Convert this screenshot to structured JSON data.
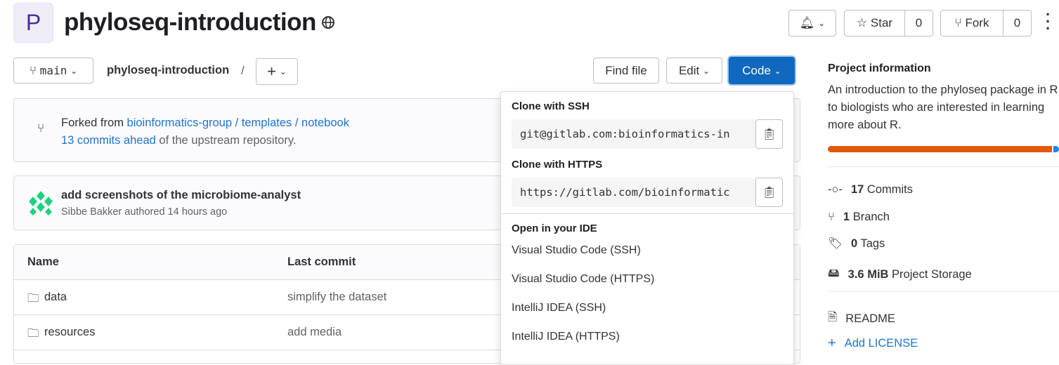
{
  "project": {
    "avatar_letter": "P",
    "title": "phyloseq-introduction",
    "visibility_icon": "globe-icon"
  },
  "header": {
    "star_label": "Star",
    "star_count": "0",
    "fork_label": "Fork",
    "fork_count": "0"
  },
  "toolbar": {
    "branch": "main",
    "breadcrumb": "phyloseq-introduction",
    "separator": "/",
    "find_file": "Find file",
    "edit": "Edit",
    "code": "Code"
  },
  "fork_info": {
    "prefix": "Forked from",
    "source": "bioinformatics-group / templates / notebook",
    "ahead": "13 commits ahead",
    "suffix": "of the upstream repository."
  },
  "last_commit": {
    "message": "add screenshots of the microbiome-analyst",
    "author_line": "Sibbe Bakker authored 14 hours ago"
  },
  "table": {
    "headers": [
      "Name",
      "Last commit"
    ],
    "rows": [
      {
        "name": "data",
        "commit": "simplify the dataset"
      },
      {
        "name": "resources",
        "commit": "add media"
      }
    ]
  },
  "code_dropdown": {
    "ssh_title": "Clone with SSH",
    "ssh_url": "git@gitlab.com:bioinformatics-in",
    "https_title": "Clone with HTTPS",
    "https_url": "https://gitlab.com/bioinformatic",
    "ide_title": "Open in your IDE",
    "ide_options": [
      "Visual Studio Code (SSH)",
      "Visual Studio Code (HTTPS)",
      "IntelliJ IDEA (SSH)",
      "IntelliJ IDEA (HTTPS)"
    ]
  },
  "sidebar": {
    "title": "Project information",
    "description": "An introduction to the phyloseq package in R, to biologists who are interested in learning more about R.",
    "languages": [
      {
        "percent": 97.5,
        "color": "#e0590b"
      },
      {
        "percent": 2.5,
        "color": "#1f87e5"
      }
    ],
    "commits_n": "17",
    "commits_l": "Commits",
    "branch_n": "1",
    "branch_l": "Branch",
    "tags_n": "0",
    "tags_l": "Tags",
    "storage_n": "3.6 MiB",
    "storage_l": "Project Storage",
    "readme": "README",
    "add_license": "Add LICENSE"
  }
}
